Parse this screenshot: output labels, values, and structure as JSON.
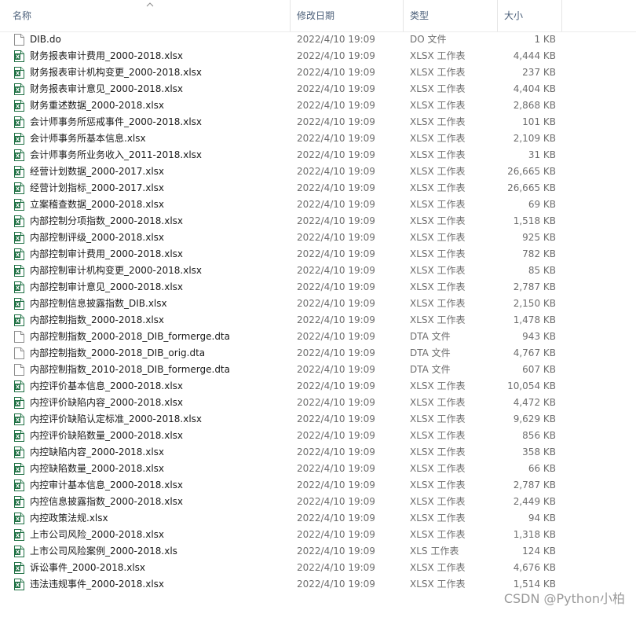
{
  "columns": {
    "name": "名称",
    "modified": "修改日期",
    "type": "类型",
    "size": "大小"
  },
  "files": [
    {
      "name": "DIB.do",
      "modified": "2022/4/10 19:09",
      "type": "DO 文件",
      "size": "1 KB",
      "icon": "file-icon"
    },
    {
      "name": "财务报表审计费用_2000-2018.xlsx",
      "modified": "2022/4/10 19:09",
      "type": "XLSX 工作表",
      "size": "4,444 KB",
      "icon": "excel-icon"
    },
    {
      "name": "财务报表审计机构变更_2000-2018.xlsx",
      "modified": "2022/4/10 19:09",
      "type": "XLSX 工作表",
      "size": "237 KB",
      "icon": "excel-icon"
    },
    {
      "name": "财务报表审计意见_2000-2018.xlsx",
      "modified": "2022/4/10 19:09",
      "type": "XLSX 工作表",
      "size": "4,404 KB",
      "icon": "excel-icon"
    },
    {
      "name": "财务重述数据_2000-2018.xlsx",
      "modified": "2022/4/10 19:09",
      "type": "XLSX 工作表",
      "size": "2,868 KB",
      "icon": "excel-icon"
    },
    {
      "name": "会计师事务所惩戒事件_2000-2018.xlsx",
      "modified": "2022/4/10 19:09",
      "type": "XLSX 工作表",
      "size": "101 KB",
      "icon": "excel-icon"
    },
    {
      "name": "会计师事务所基本信息.xlsx",
      "modified": "2022/4/10 19:09",
      "type": "XLSX 工作表",
      "size": "2,109 KB",
      "icon": "excel-icon"
    },
    {
      "name": "会计师事务所业务收入_2011-2018.xlsx",
      "modified": "2022/4/10 19:09",
      "type": "XLSX 工作表",
      "size": "31 KB",
      "icon": "excel-icon"
    },
    {
      "name": "经营计划数据_2000-2017.xlsx",
      "modified": "2022/4/10 19:09",
      "type": "XLSX 工作表",
      "size": "26,665 KB",
      "icon": "excel-icon"
    },
    {
      "name": "经营计划指标_2000-2017.xlsx",
      "modified": "2022/4/10 19:09",
      "type": "XLSX 工作表",
      "size": "26,665 KB",
      "icon": "excel-icon"
    },
    {
      "name": "立案稽查数据_2000-2018.xlsx",
      "modified": "2022/4/10 19:09",
      "type": "XLSX 工作表",
      "size": "69 KB",
      "icon": "excel-icon"
    },
    {
      "name": "内部控制分项指数_2000-2018.xlsx",
      "modified": "2022/4/10 19:09",
      "type": "XLSX 工作表",
      "size": "1,518 KB",
      "icon": "excel-icon"
    },
    {
      "name": "内部控制评级_2000-2018.xlsx",
      "modified": "2022/4/10 19:09",
      "type": "XLSX 工作表",
      "size": "925 KB",
      "icon": "excel-icon"
    },
    {
      "name": "内部控制审计费用_2000-2018.xlsx",
      "modified": "2022/4/10 19:09",
      "type": "XLSX 工作表",
      "size": "782 KB",
      "icon": "excel-icon"
    },
    {
      "name": "内部控制审计机构变更_2000-2018.xlsx",
      "modified": "2022/4/10 19:09",
      "type": "XLSX 工作表",
      "size": "85 KB",
      "icon": "excel-icon"
    },
    {
      "name": "内部控制审计意见_2000-2018.xlsx",
      "modified": "2022/4/10 19:09",
      "type": "XLSX 工作表",
      "size": "2,787 KB",
      "icon": "excel-icon"
    },
    {
      "name": "内部控制信息披露指数_DIB.xlsx",
      "modified": "2022/4/10 19:09",
      "type": "XLSX 工作表",
      "size": "2,150 KB",
      "icon": "excel-icon"
    },
    {
      "name": "内部控制指数_2000-2018.xlsx",
      "modified": "2022/4/10 19:09",
      "type": "XLSX 工作表",
      "size": "1,478 KB",
      "icon": "excel-icon"
    },
    {
      "name": "内部控制指数_2000-2018_DIB_formerge.dta",
      "modified": "2022/4/10 19:09",
      "type": "DTA 文件",
      "size": "943 KB",
      "icon": "file-icon"
    },
    {
      "name": "内部控制指数_2000-2018_DIB_orig.dta",
      "modified": "2022/4/10 19:09",
      "type": "DTA 文件",
      "size": "4,767 KB",
      "icon": "file-icon"
    },
    {
      "name": "内部控制指数_2010-2018_DIB_formerge.dta",
      "modified": "2022/4/10 19:09",
      "type": "DTA 文件",
      "size": "607 KB",
      "icon": "file-icon"
    },
    {
      "name": "内控评价基本信息_2000-2018.xlsx",
      "modified": "2022/4/10 19:09",
      "type": "XLSX 工作表",
      "size": "10,054 KB",
      "icon": "excel-icon"
    },
    {
      "name": "内控评价缺陷内容_2000-2018.xlsx",
      "modified": "2022/4/10 19:09",
      "type": "XLSX 工作表",
      "size": "4,472 KB",
      "icon": "excel-icon"
    },
    {
      "name": "内控评价缺陷认定标准_2000-2018.xlsx",
      "modified": "2022/4/10 19:09",
      "type": "XLSX 工作表",
      "size": "9,629 KB",
      "icon": "excel-icon"
    },
    {
      "name": "内控评价缺陷数量_2000-2018.xlsx",
      "modified": "2022/4/10 19:09",
      "type": "XLSX 工作表",
      "size": "856 KB",
      "icon": "excel-icon"
    },
    {
      "name": "内控缺陷内容_2000-2018.xlsx",
      "modified": "2022/4/10 19:09",
      "type": "XLSX 工作表",
      "size": "358 KB",
      "icon": "excel-icon"
    },
    {
      "name": "内控缺陷数量_2000-2018.xlsx",
      "modified": "2022/4/10 19:09",
      "type": "XLSX 工作表",
      "size": "66 KB",
      "icon": "excel-icon"
    },
    {
      "name": "内控审计基本信息_2000-2018.xlsx",
      "modified": "2022/4/10 19:09",
      "type": "XLSX 工作表",
      "size": "2,787 KB",
      "icon": "excel-icon"
    },
    {
      "name": "内控信息披露指数_2000-2018.xlsx",
      "modified": "2022/4/10 19:09",
      "type": "XLSX 工作表",
      "size": "2,449 KB",
      "icon": "excel-icon"
    },
    {
      "name": "内控政策法规.xlsx",
      "modified": "2022/4/10 19:09",
      "type": "XLSX 工作表",
      "size": "94 KB",
      "icon": "excel-icon"
    },
    {
      "name": "上市公司风险_2000-2018.xlsx",
      "modified": "2022/4/10 19:09",
      "type": "XLSX 工作表",
      "size": "1,318 KB",
      "icon": "excel-icon"
    },
    {
      "name": "上市公司风险案例_2000-2018.xls",
      "modified": "2022/4/10 19:09",
      "type": "XLS 工作表",
      "size": "124 KB",
      "icon": "excel-icon"
    },
    {
      "name": "诉讼事件_2000-2018.xlsx",
      "modified": "2022/4/10 19:09",
      "type": "XLSX 工作表",
      "size": "4,676 KB",
      "icon": "excel-icon"
    },
    {
      "name": "违法违规事件_2000-2018.xlsx",
      "modified": "2022/4/10 19:09",
      "type": "XLSX 工作表",
      "size": "1,514 KB",
      "icon": "excel-icon"
    }
  ],
  "watermark": "CSDN @Python小柏",
  "colors": {
    "excel_green": "#1d6f42",
    "header_text": "#4c607a",
    "meta_text": "#6d6d6d"
  }
}
